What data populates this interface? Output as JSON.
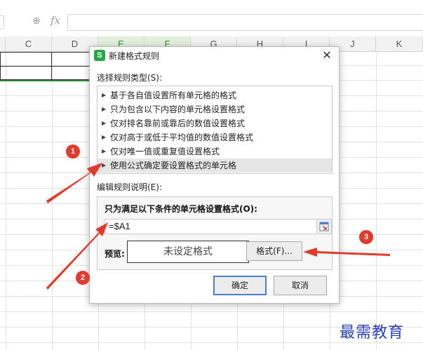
{
  "formula_bar": {
    "zoom_icon": "zoom-icon",
    "fx_label": "fx"
  },
  "columns": [
    "C",
    "D",
    "E",
    "F",
    "G",
    "H",
    "I",
    "J",
    "K"
  ],
  "dialog": {
    "title": "新建格式规则",
    "app_icon_letter": "S",
    "close_symbol": "✕",
    "rule_type_label": "选择规则类型(S):",
    "rule_types": [
      "基于各自值设置所有单元格的格式",
      "只为包含以下内容的单元格设置格式",
      "仅对排名靠前或靠后的数值设置格式",
      "仅对高于或低于平均值的数值设置格式",
      "仅对唯一值或重复值设置格式",
      "使用公式确定要设置格式的单元格"
    ],
    "selected_rule_index": 5,
    "edit_label": "编辑规则说明(E):",
    "formula_heading": "只为满足以下条件的单元格设置格式(O):",
    "formula_value": "=$A1",
    "preview_label": "预览:",
    "preview_text": "未设定格式",
    "format_button": "格式(F)...",
    "ok_button": "确定",
    "cancel_button": "取消"
  },
  "annotations": {
    "badges": [
      "1",
      "2",
      "3"
    ],
    "color": "#e23a2c"
  },
  "watermark": "最需教育",
  "colors": {
    "accent_green": "#2f8a3c",
    "ok_border": "#4a7fd0",
    "watermark": "#2a3fb5"
  }
}
